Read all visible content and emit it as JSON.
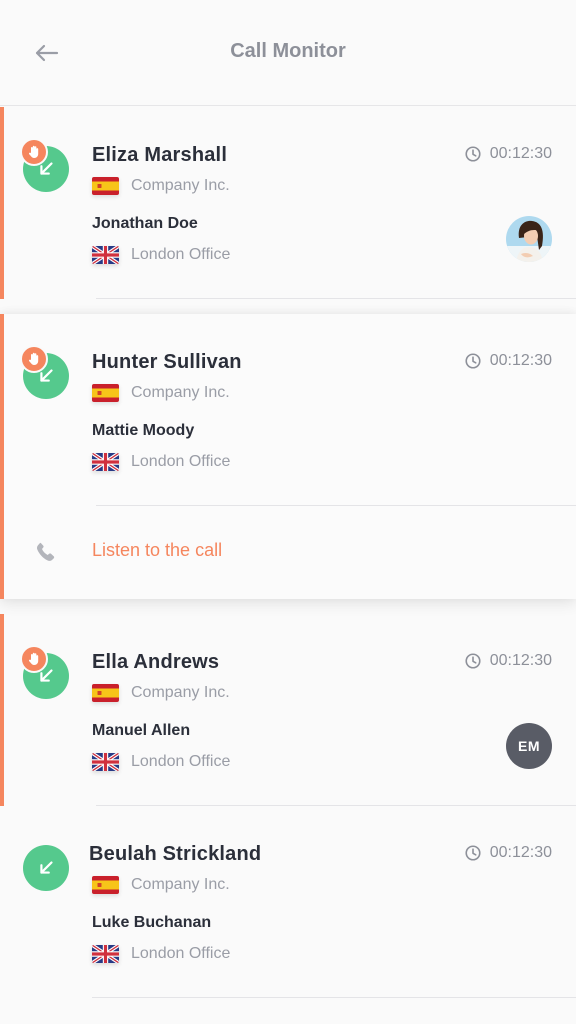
{
  "header": {
    "title": "Call Monitor"
  },
  "colors": {
    "accent": "#f5865e",
    "call_green": "#55c98d",
    "initials_bg": "#595c66"
  },
  "calls": [
    {
      "caller": "Eliza Marshall",
      "company": "Company Inc.",
      "company_flag": "spain-flag",
      "agent": "Jonathan Doe",
      "office": "London Office",
      "office_flag": "uk-flag",
      "duration": "00:12:30",
      "hand_raised": true,
      "avatar": "agent-photo"
    },
    {
      "caller": "Hunter Sullivan",
      "company": "Company Inc.",
      "company_flag": "spain-flag",
      "agent": "Mattie Moody",
      "office": "London Office",
      "office_flag": "uk-flag",
      "duration": "00:12:30",
      "hand_raised": true,
      "action": {
        "label": "Listen to the call",
        "icon": "phone-icon"
      }
    },
    {
      "caller": "Ella Andrews",
      "company": "Company Inc.",
      "company_flag": "spain-flag",
      "agent": "Manuel Allen",
      "office": "London Office",
      "office_flag": "uk-flag",
      "duration": "00:12:30",
      "hand_raised": true,
      "avatar_initials": "EM"
    },
    {
      "caller": "Beulah Strickland",
      "company": "Company Inc.",
      "company_flag": "spain-flag",
      "agent": "Luke Buchanan",
      "office": "London Office",
      "office_flag": "uk-flag",
      "duration": "00:12:30",
      "hand_raised": false
    }
  ]
}
